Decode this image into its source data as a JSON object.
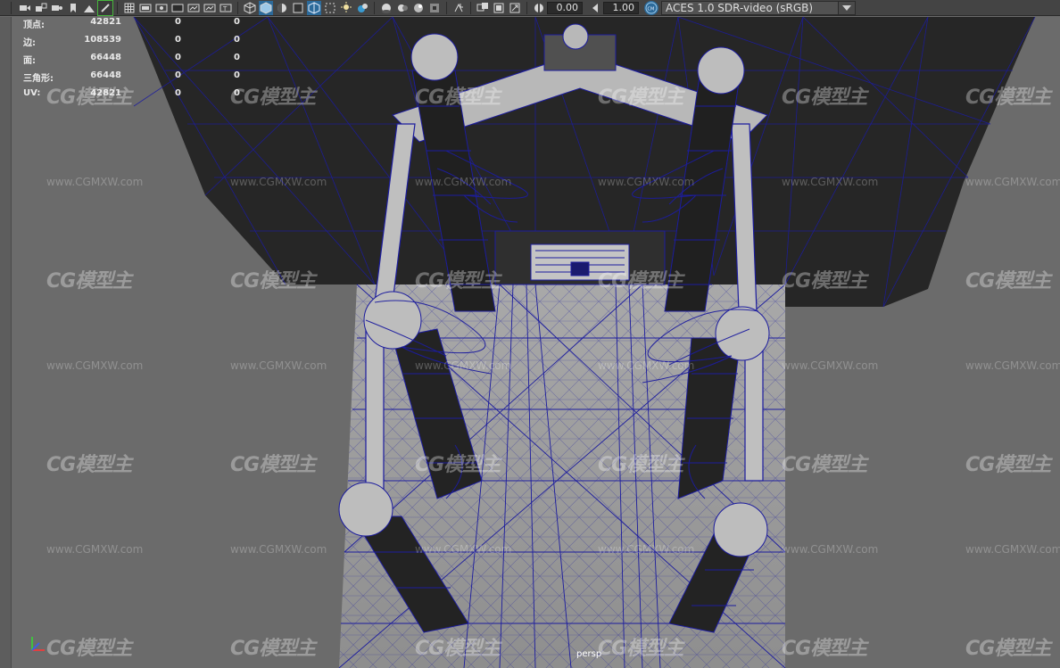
{
  "toolbar": {
    "icons": [
      "camera-icon",
      "camera-lock-icon",
      "camera-attributes-icon",
      "bookmark-icon",
      "image-plane-icon",
      "grease-pencil-icon",
      "grid-icon",
      "film-gate-icon",
      "resolution-gate-icon",
      "gate-mask-icon",
      "field-chart-icon",
      "safe-action-icon",
      "safe-title-icon",
      "wireframe-icon",
      "smooth-shade-icon",
      "default-material-icon",
      "wireframe-on-shaded-icon",
      "xray-icon",
      "use-lights-icon",
      "shadows-icon",
      "screen-space-ao-icon",
      "motion-blur-icon",
      "anti-aliasing-icon",
      "depth-of-field-icon",
      "isolate-select-icon",
      "xray-joints-icon",
      "xray-active-icon",
      "backface-culling-icon",
      "gamma-icon",
      "exposure-icon",
      "color-management-icon"
    ],
    "gamma_value": "0.00",
    "exposure_value": "1.00",
    "color_space": "ACES 1.0 SDR-video (sRGB)"
  },
  "hud": {
    "rows": [
      {
        "label": "顶点:",
        "v1": "42821",
        "v2": "0",
        "v3": "0"
      },
      {
        "label": "边:",
        "v1": "108539",
        "v2": "0",
        "v3": "0"
      },
      {
        "label": "面:",
        "v1": "66448",
        "v2": "0",
        "v3": "0"
      },
      {
        "label": "三角形:",
        "v1": "66448",
        "v2": "0",
        "v3": "0"
      },
      {
        "label": "UV:",
        "v1": "42821",
        "v2": "0",
        "v3": "0"
      }
    ]
  },
  "viewport": {
    "camera": "persp",
    "watermark_logo": "CG模型主",
    "watermark_url": "www.CGMXW.com"
  },
  "colors": {
    "viewport_bg": "#6b6b6b",
    "ceiling": "#262626",
    "floor": "#9a9a9a",
    "wire": "#1c1c9e",
    "toolbar_bg": "#444444",
    "active_tool": "#46b63c"
  }
}
